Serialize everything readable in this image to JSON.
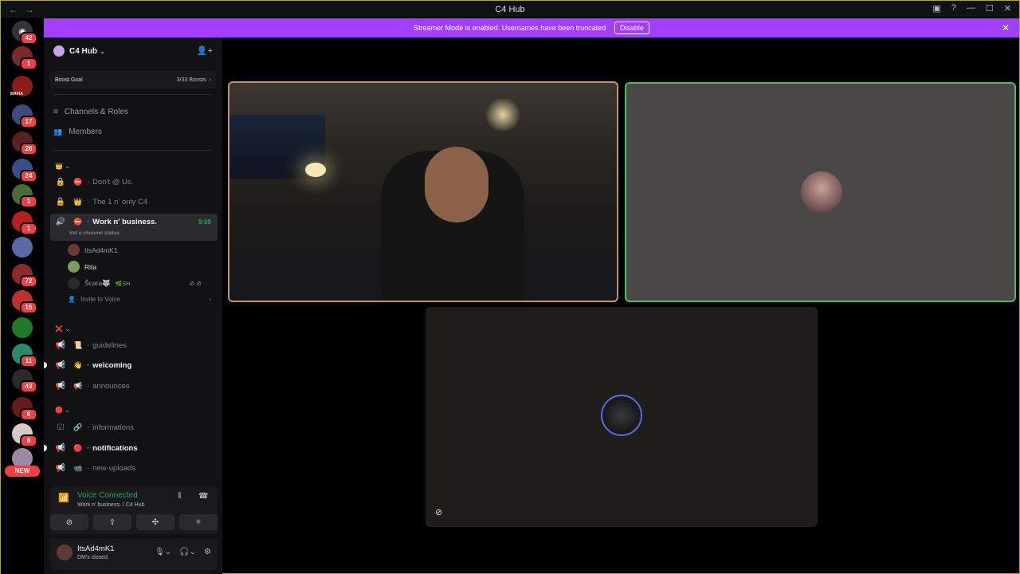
{
  "window": {
    "title": "C4 Hub",
    "nav_back": "←",
    "nav_forward": "→",
    "controls": {
      "inbox": "▣",
      "help": "?",
      "minimize": "—",
      "maximize": "☐",
      "close": "✕"
    }
  },
  "rail": {
    "home_badge": "42",
    "servers": [
      {
        "badge": "1",
        "color": "#7a2a2a"
      },
      {
        "label": "MAFIA",
        "color": "#8a1c1c"
      },
      {
        "badge": "17",
        "color": "#3d4a7a"
      },
      {
        "badge": "26",
        "color": "#5a2020"
      },
      {
        "badge": "24",
        "color": "#3a4f8a"
      },
      {
        "badge": "1",
        "color": "#4a6a3a"
      },
      {
        "badge": "1",
        "color": "#b82020"
      },
      {
        "badge": "",
        "color": "#5a6aa8"
      },
      {
        "badge": "72",
        "color": "#8a2a2a"
      },
      {
        "badge": "15",
        "color": "#c03030"
      },
      {
        "badge": "",
        "color": "#1f7a2a"
      },
      {
        "badge": "11",
        "color": "#2a8a6a"
      },
      {
        "badge": "43",
        "color": "#2a2a2a"
      },
      {
        "badge": "6",
        "color": "#6a1a1a"
      },
      {
        "badge": "8",
        "color": "#d8c8c8"
      },
      {
        "badge": "",
        "color": "#9a8aa8"
      }
    ],
    "new_label": "NEW"
  },
  "banner": {
    "text": "Streamer Mode is enabled. Usernames have been truncated.",
    "button": "Disable",
    "close": "✕"
  },
  "sidebar": {
    "guild_name": "C4 Hub",
    "boost_label": "Boost Goal",
    "boost_count": "3/33 Boosts",
    "menu": [
      {
        "label": "Channels & Roles",
        "icon": "≡"
      },
      {
        "label": "Members",
        "icon": "👥"
      }
    ],
    "categories": [
      {
        "icon": "👑",
        "chev": "⌄"
      },
      {
        "icon": "❌",
        "chev": "⌄"
      },
      {
        "icon": "🔴",
        "chev": "⌄"
      }
    ],
    "voice_channels": [
      {
        "name": "Don't @ Us.",
        "emoji": "⛔",
        "icon": "🔒"
      },
      {
        "name": "The 1 n' only C4",
        "emoji": "👑",
        "icon": "🔒"
      },
      {
        "name": "Work n' business.",
        "emoji": "⛔",
        "icon": "🔊",
        "time": "9:09",
        "status": "Set a channel status"
      }
    ],
    "voice_users": [
      {
        "name": "ItsAd4mK1",
        "color": "#6b3b33"
      },
      {
        "name": "Rita",
        "color": "#7a9a5a"
      },
      {
        "name": "Šcara🐺",
        "tag": "🌿SH",
        "color": "#2a2a2a",
        "icons": "⊘ ⊘"
      }
    ],
    "invite_voice": "Invite to Voice",
    "text_channels_a": [
      {
        "name": "guidelines",
        "emoji": "📜"
      },
      {
        "name": "welcoming",
        "emoji": "👋"
      },
      {
        "name": "announces",
        "emoji": "📢"
      }
    ],
    "text_channels_b": [
      {
        "name": "informations",
        "emoji": "🔗"
      },
      {
        "name": "notifications",
        "emoji": "🔴"
      },
      {
        "name": "new-uploads",
        "emoji": "📹"
      }
    ]
  },
  "voice_panel": {
    "title": "Voice Connected",
    "channel": "Work n' business. / C4 Hub",
    "actions": [
      "⊘",
      "⇪",
      "✣",
      "✧"
    ]
  },
  "user_panel": {
    "name": "ItsAd4mK1",
    "status": "DM's closed."
  },
  "stage": {
    "mute_icon": "⊘"
  }
}
